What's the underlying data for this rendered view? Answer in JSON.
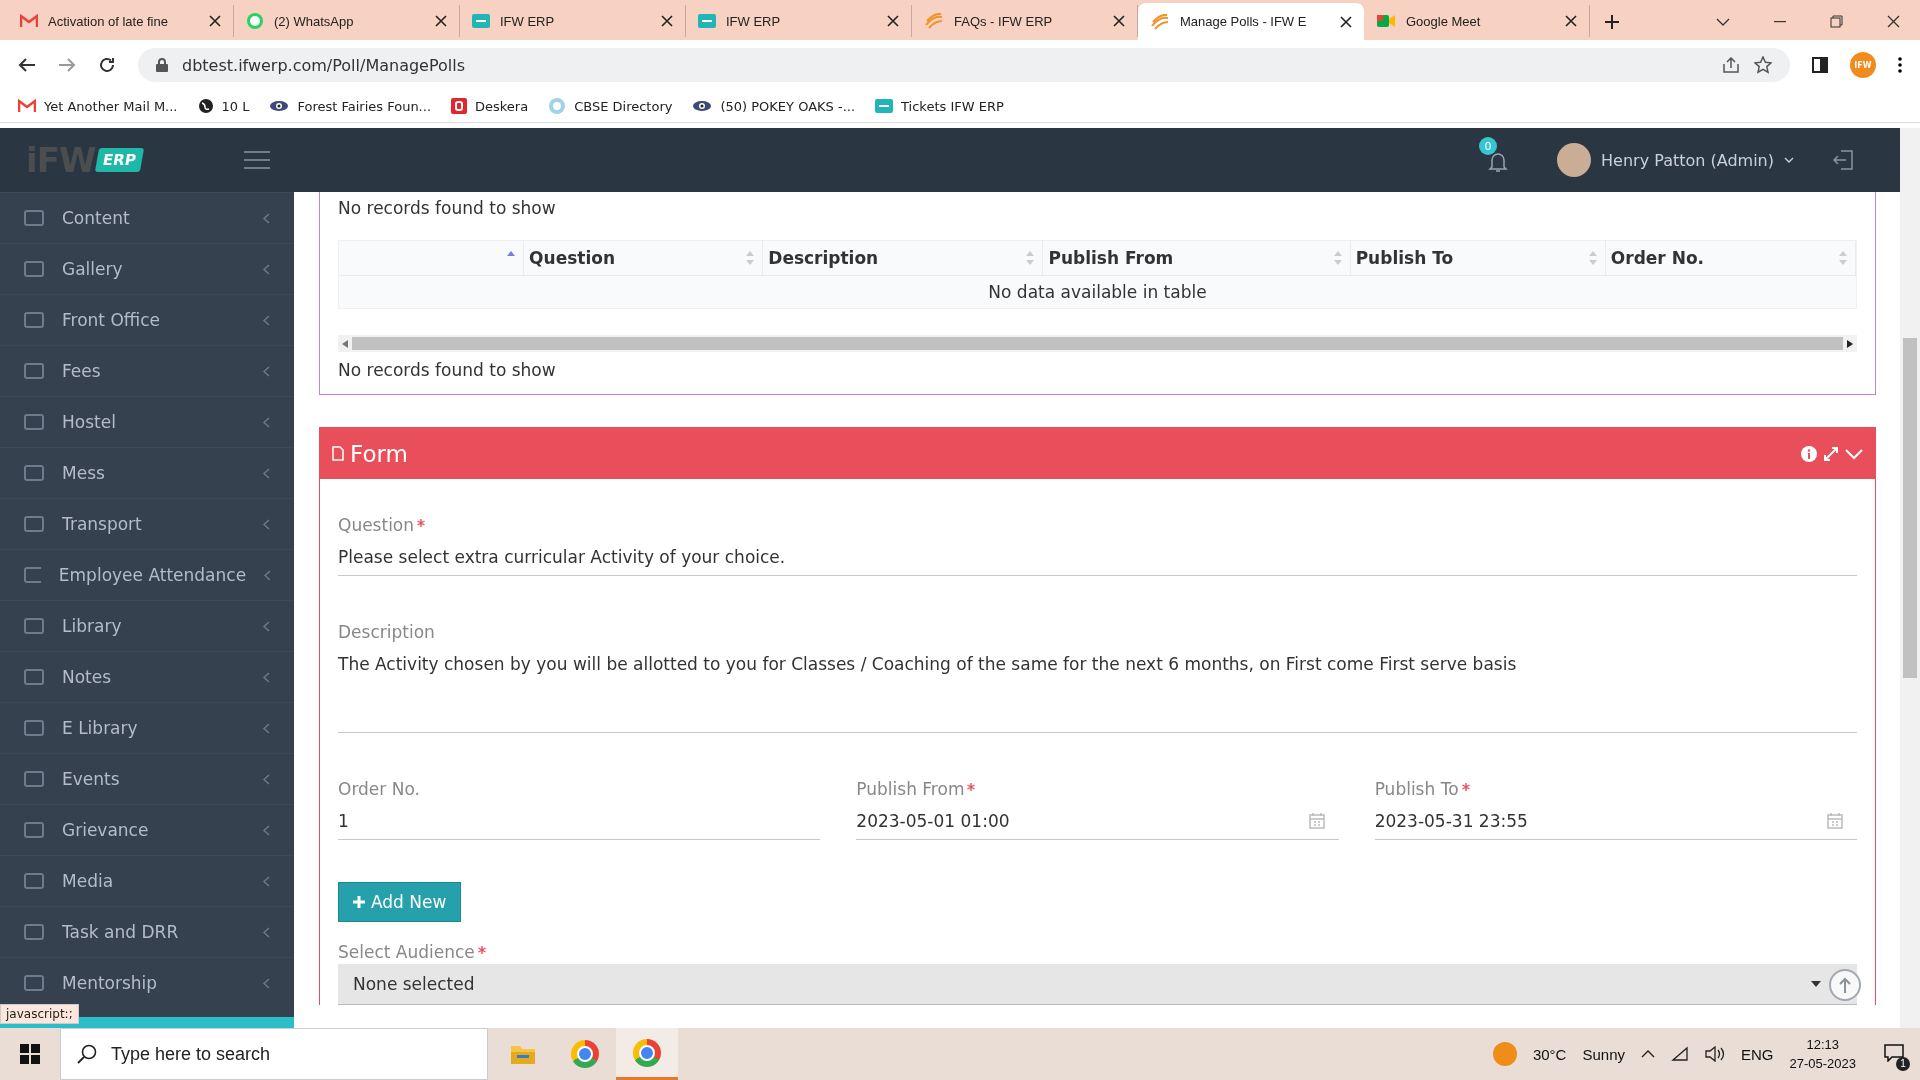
{
  "browser": {
    "tabs": [
      {
        "title": "Activation of late fine",
        "kind": "mail",
        "selected": false
      },
      {
        "title": "(2) WhatsApp",
        "kind": "chat",
        "selected": false
      },
      {
        "title": "IFW ERP",
        "kind": "erp",
        "selected": false
      },
      {
        "title": "IFW ERP",
        "kind": "erp",
        "selected": false
      },
      {
        "title": "FAQs - IFW ERP",
        "kind": "faq",
        "selected": false
      },
      {
        "title": "Manage Polls - IFW E",
        "kind": "faq",
        "selected": true
      },
      {
        "title": "Google Meet",
        "kind": "video",
        "selected": false
      }
    ],
    "url": "dbtest.ifwerp.com/Poll/ManagePolls",
    "profile_initials": "IFW",
    "bookmarks": [
      {
        "title": "Yet Another Mail M...",
        "kind": "mail"
      },
      {
        "title": "10 L",
        "kind": "globe"
      },
      {
        "title": "Forest Fairies Foun...",
        "kind": "eye"
      },
      {
        "title": "Deskera",
        "kind": "letter"
      },
      {
        "title": "CBSE Directory",
        "kind": "seal"
      },
      {
        "title": "(50) POKEY OAKS -...",
        "kind": "eye"
      },
      {
        "title": "Tickets IFW ERP",
        "kind": "erp"
      }
    ]
  },
  "header": {
    "logo": "iFW",
    "logo_badge": "ERP",
    "notification_count": "0",
    "user": "Henry Patton (Admin)"
  },
  "sidebar": {
    "items": [
      "Content",
      "Gallery",
      "Front Office",
      "Fees",
      "Hostel",
      "Mess",
      "Transport",
      "Employee Attendance",
      "Library",
      "Notes",
      "E Library",
      "Events",
      "Grievance",
      "Media",
      "Task and DRR",
      "Mentorship"
    ]
  },
  "records": {
    "top_message": "No records found to show",
    "columns": [
      {
        "sorted": true
      },
      {
        "label": "Question",
        "sorted": false
      },
      {
        "label": "Description",
        "sorted": false
      },
      {
        "label": "Publish From",
        "sorted": false
      },
      {
        "label": "Publish To",
        "sorted": false
      },
      {
        "label": "Order No.",
        "sorted": false
      }
    ],
    "empty_text": "No data available in table",
    "bottom_message": "No records found to show"
  },
  "form": {
    "title": "Form",
    "rows": [
      [
        {
          "label": "Question",
          "required": true,
          "value": "Please select extra curricular Activity of your choice.",
          "kind": "text"
        }
      ],
      [
        {
          "label": "Description",
          "required": false,
          "value": "The Activity chosen by you will be allotted to you for Classes / Coaching of the same for the next 6 months, on First come First serve basis",
          "kind": "textarea"
        }
      ],
      [
        {
          "label": "Order No.",
          "required": false,
          "value": "1",
          "kind": "text"
        },
        {
          "label": "Publish From",
          "required": true,
          "value": "2023-05-01 01:00",
          "kind": "date"
        },
        {
          "label": "Publish To",
          "required": true,
          "value": "2023-05-31 23:55",
          "kind": "date"
        }
      ]
    ],
    "add_button": "Add New",
    "audience": {
      "label": "Select Audience",
      "required": true,
      "value": "None selected"
    }
  },
  "status_hint": "javascript:;",
  "taskbar": {
    "search_placeholder": "Type here to search",
    "temperature": "30°C",
    "weather": "Sunny",
    "language": "ENG",
    "time": "12:13",
    "date": "27-05-2023",
    "notifications": "1"
  }
}
